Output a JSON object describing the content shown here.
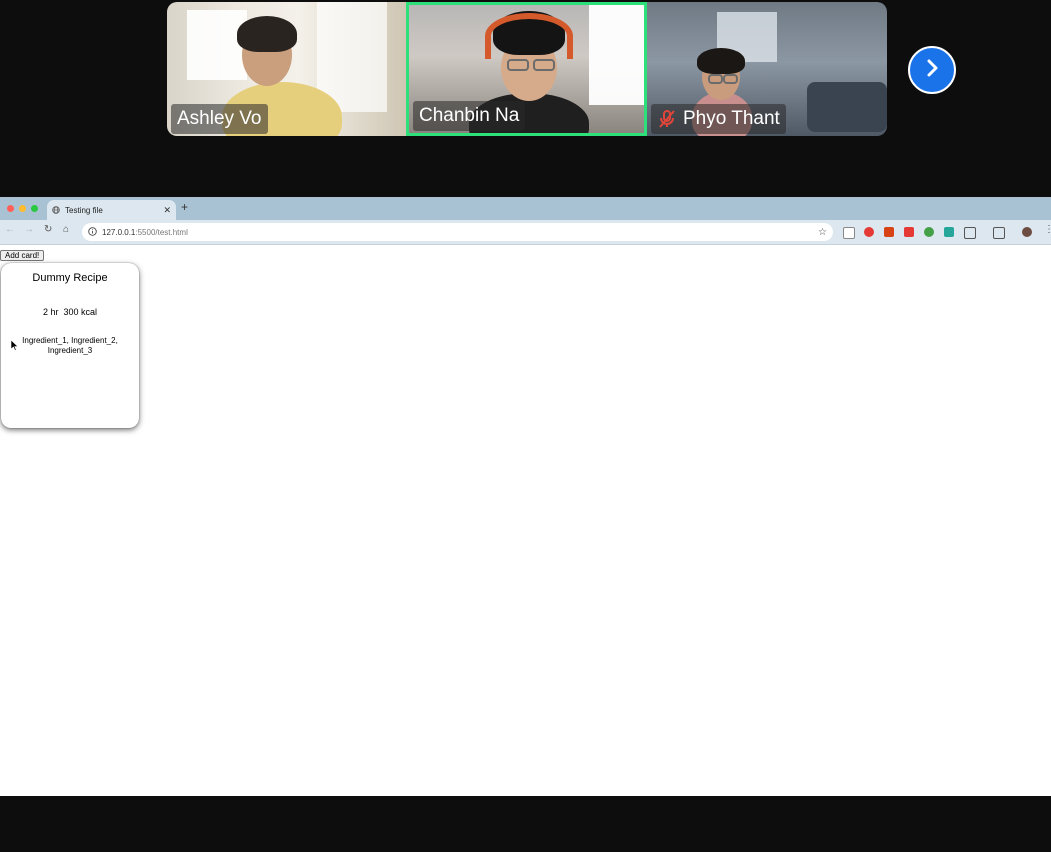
{
  "video_call": {
    "participants": [
      {
        "name": "Ashley Vo",
        "muted": false
      },
      {
        "name": "Chanbin Na",
        "muted": false,
        "active_speaker": true
      },
      {
        "name": "Phyo Thant",
        "muted": true
      }
    ],
    "next_icon": "chevron-right-icon",
    "accent_color": "#1a73e8",
    "speaker_border_color": "#2ee07a"
  },
  "browser": {
    "tab": {
      "title": "Testing file",
      "close_icon": "close-icon",
      "favicon": "globe-icon"
    },
    "new_tab_icon": "plus-icon",
    "address": {
      "host": "127.0.0.1",
      "path": ":5500/test.html"
    },
    "bookmark_icon": "star-icon"
  },
  "page": {
    "add_card_label": "Add card!",
    "card": {
      "title": "Dummy Recipe",
      "meta": "2 hr  300 kcal",
      "ingredients": "Ingredient_1, Ingredient_2, Ingredient_3"
    }
  }
}
